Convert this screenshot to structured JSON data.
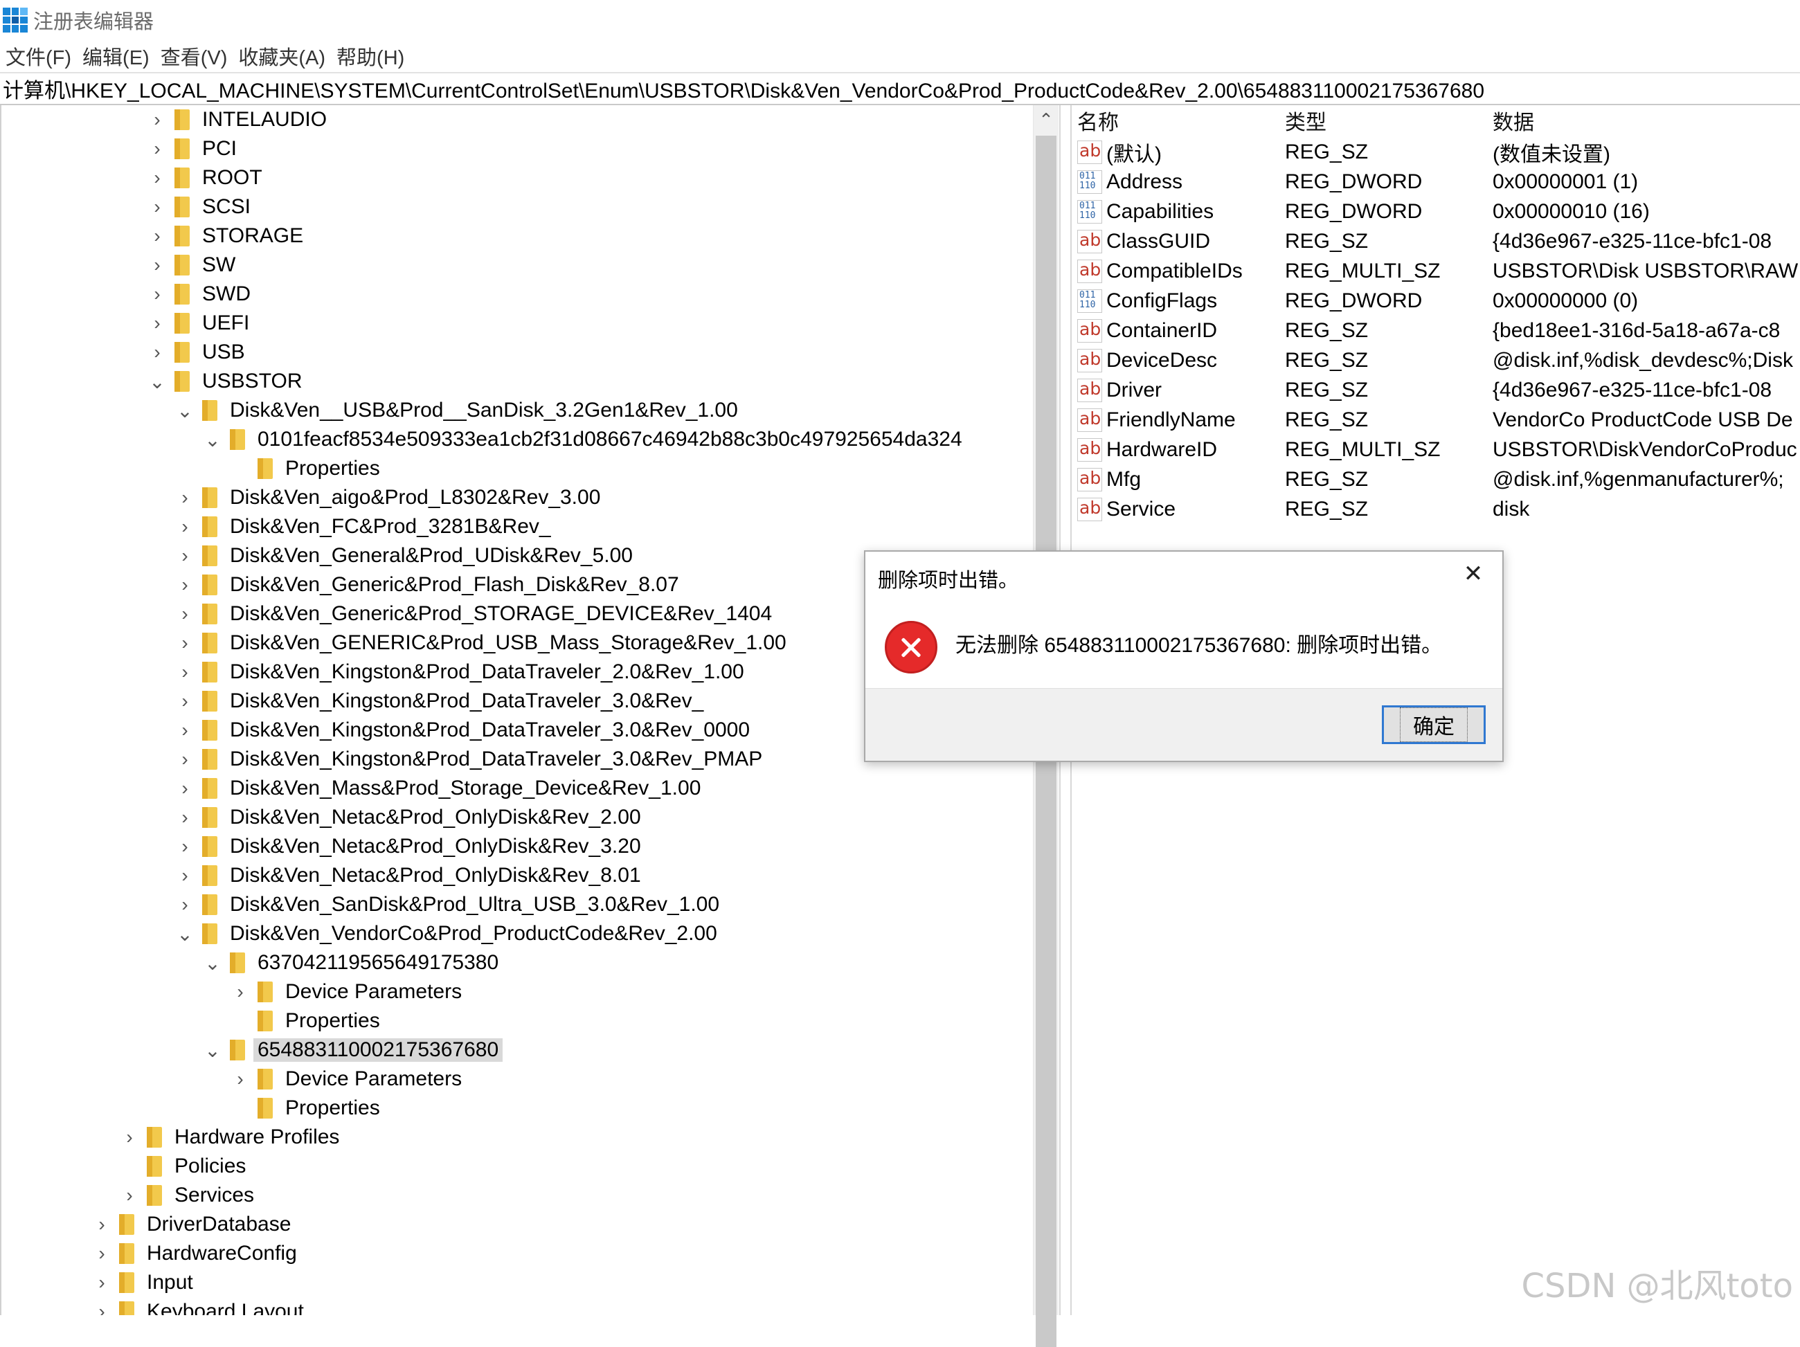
{
  "window": {
    "title": "注册表编辑器"
  },
  "menu": [
    "文件(F)",
    "编辑(E)",
    "查看(V)",
    "收藏夹(A)",
    "帮助(H)"
  ],
  "address": "计算机\\HKEY_LOCAL_MACHINE\\SYSTEM\\CurrentControlSet\\Enum\\USBSTOR\\Disk&Ven_VendorCo&Prod_ProductCode&Rev_2.00\\654883110002175367680",
  "tree": [
    {
      "label": "INTELAUDIO",
      "level": 3,
      "chevron": ">"
    },
    {
      "label": "PCI",
      "level": 3,
      "chevron": ">"
    },
    {
      "label": "ROOT",
      "level": 3,
      "chevron": ">"
    },
    {
      "label": "SCSI",
      "level": 3,
      "chevron": ">"
    },
    {
      "label": "STORAGE",
      "level": 3,
      "chevron": ">"
    },
    {
      "label": "SW",
      "level": 3,
      "chevron": ">"
    },
    {
      "label": "SWD",
      "level": 3,
      "chevron": ">"
    },
    {
      "label": "UEFI",
      "level": 3,
      "chevron": ">"
    },
    {
      "label": "USB",
      "level": 3,
      "chevron": ">"
    },
    {
      "label": "USBSTOR",
      "level": 3,
      "chevron": "v"
    },
    {
      "label": "Disk&Ven__USB&Prod__SanDisk_3.2Gen1&Rev_1.00",
      "level": 4,
      "chevron": "v"
    },
    {
      "label": "0101feacf8534e509333ea1cb2f31d08667c46942b88c3b0c497925654da324",
      "level": 5,
      "chevron": "v"
    },
    {
      "label": "Properties",
      "level": 6,
      "chevron": ""
    },
    {
      "label": "Disk&Ven_aigo&Prod_L8302&Rev_3.00",
      "level": 4,
      "chevron": ">"
    },
    {
      "label": "Disk&Ven_FC&Prod_3281B&Rev_",
      "level": 4,
      "chevron": ">"
    },
    {
      "label": "Disk&Ven_General&Prod_UDisk&Rev_5.00",
      "level": 4,
      "chevron": ">"
    },
    {
      "label": "Disk&Ven_Generic&Prod_Flash_Disk&Rev_8.07",
      "level": 4,
      "chevron": ">"
    },
    {
      "label": "Disk&Ven_Generic&Prod_STORAGE_DEVICE&Rev_1404",
      "level": 4,
      "chevron": ">"
    },
    {
      "label": "Disk&Ven_GENERIC&Prod_USB_Mass_Storage&Rev_1.00",
      "level": 4,
      "chevron": ">"
    },
    {
      "label": "Disk&Ven_Kingston&Prod_DataTraveler_2.0&Rev_1.00",
      "level": 4,
      "chevron": ">"
    },
    {
      "label": "Disk&Ven_Kingston&Prod_DataTraveler_3.0&Rev_",
      "level": 4,
      "chevron": ">"
    },
    {
      "label": "Disk&Ven_Kingston&Prod_DataTraveler_3.0&Rev_0000",
      "level": 4,
      "chevron": ">"
    },
    {
      "label": "Disk&Ven_Kingston&Prod_DataTraveler_3.0&Rev_PMAP",
      "level": 4,
      "chevron": ">"
    },
    {
      "label": "Disk&Ven_Mass&Prod_Storage_Device&Rev_1.00",
      "level": 4,
      "chevron": ">"
    },
    {
      "label": "Disk&Ven_Netac&Prod_OnlyDisk&Rev_2.00",
      "level": 4,
      "chevron": ">"
    },
    {
      "label": "Disk&Ven_Netac&Prod_OnlyDisk&Rev_3.20",
      "level": 4,
      "chevron": ">"
    },
    {
      "label": "Disk&Ven_Netac&Prod_OnlyDisk&Rev_8.01",
      "level": 4,
      "chevron": ">"
    },
    {
      "label": "Disk&Ven_SanDisk&Prod_Ultra_USB_3.0&Rev_1.00",
      "level": 4,
      "chevron": ">"
    },
    {
      "label": "Disk&Ven_VendorCo&Prod_ProductCode&Rev_2.00",
      "level": 4,
      "chevron": "v"
    },
    {
      "label": "637042119565649175380",
      "level": 5,
      "chevron": "v"
    },
    {
      "label": "Device Parameters",
      "level": 6,
      "chevron": ">"
    },
    {
      "label": "Properties",
      "level": 6,
      "chevron": ""
    },
    {
      "label": "654883110002175367680",
      "level": 5,
      "chevron": "v",
      "selected": true
    },
    {
      "label": "Device Parameters",
      "level": 6,
      "chevron": ">"
    },
    {
      "label": "Properties",
      "level": 6,
      "chevron": ""
    },
    {
      "label": "Hardware Profiles",
      "level": 2,
      "chevron": ">"
    },
    {
      "label": "Policies",
      "level": 2,
      "chevron": ""
    },
    {
      "label": "Services",
      "level": 2,
      "chevron": ">"
    },
    {
      "label": "DriverDatabase",
      "level": 1,
      "chevron": ">"
    },
    {
      "label": "HardwareConfig",
      "level": 1,
      "chevron": ">"
    },
    {
      "label": "Input",
      "level": 1,
      "chevron": ">"
    },
    {
      "label": "Keyboard Layout",
      "level": 1,
      "chevron": ">"
    }
  ],
  "values": {
    "headers": [
      "名称",
      "类型",
      "数据"
    ],
    "rows": [
      {
        "icon": "string-value-icon",
        "name": "(默认)",
        "type": "REG_SZ",
        "data": "(数值未设置)"
      },
      {
        "icon": "binary-value-icon",
        "name": "Address",
        "type": "REG_DWORD",
        "data": "0x00000001 (1)"
      },
      {
        "icon": "binary-value-icon",
        "name": "Capabilities",
        "type": "REG_DWORD",
        "data": "0x00000010 (16)"
      },
      {
        "icon": "string-value-icon",
        "name": "ClassGUID",
        "type": "REG_SZ",
        "data": "{4d36e967-e325-11ce-bfc1-08"
      },
      {
        "icon": "string-value-icon",
        "name": "CompatibleIDs",
        "type": "REG_MULTI_SZ",
        "data": "USBSTOR\\Disk USBSTOR\\RAW"
      },
      {
        "icon": "binary-value-icon",
        "name": "ConfigFlags",
        "type": "REG_DWORD",
        "data": "0x00000000 (0)"
      },
      {
        "icon": "string-value-icon",
        "name": "ContainerID",
        "type": "REG_SZ",
        "data": "{bed18ee1-316d-5a18-a67a-c8"
      },
      {
        "icon": "string-value-icon",
        "name": "DeviceDesc",
        "type": "REG_SZ",
        "data": "@disk.inf,%disk_devdesc%;Disk"
      },
      {
        "icon": "string-value-icon",
        "name": "Driver",
        "type": "REG_SZ",
        "data": "{4d36e967-e325-11ce-bfc1-08"
      },
      {
        "icon": "string-value-icon",
        "name": "FriendlyName",
        "type": "REG_SZ",
        "data": "VendorCo ProductCode USB De"
      },
      {
        "icon": "string-value-icon",
        "name": "HardwareID",
        "type": "REG_MULTI_SZ",
        "data": "USBSTOR\\DiskVendorCoProduc"
      },
      {
        "icon": "string-value-icon",
        "name": "Mfg",
        "type": "REG_SZ",
        "data": "@disk.inf,%genmanufacturer%;"
      },
      {
        "icon": "string-value-icon",
        "name": "Service",
        "type": "REG_SZ",
        "data": "disk"
      }
    ]
  },
  "dialog": {
    "title": "删除项时出错。",
    "message": "无法删除 654883110002175367680: 删除项时出错。",
    "ok_label": "确定",
    "close_glyph": "✕"
  },
  "watermark": "CSDN @北风toto",
  "colors": {
    "error": "#e52a2a",
    "selection": "#d9d9d9",
    "folder": "#f2c94c",
    "button_focus": "#2f78d1"
  }
}
